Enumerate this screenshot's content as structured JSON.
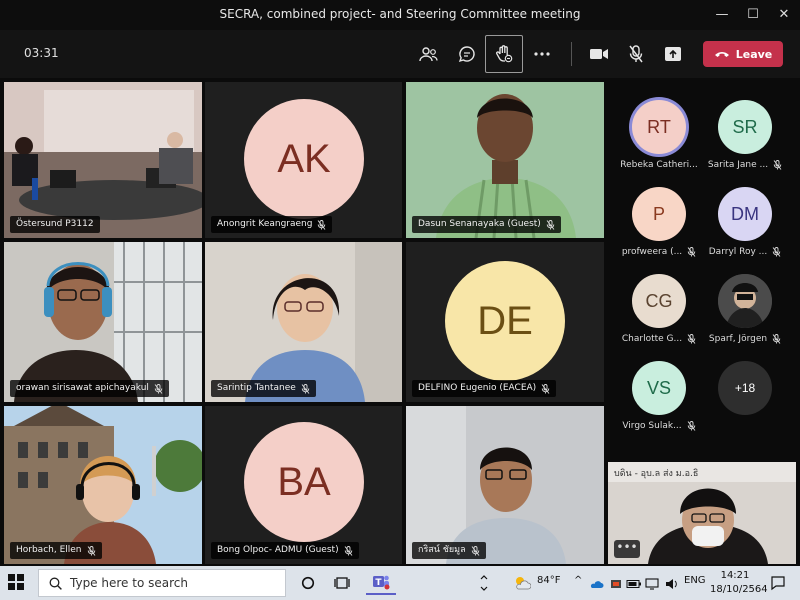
{
  "window": {
    "title": "SECRA, combined project- and Steering Committee meeting",
    "minimize_glyph": "—",
    "maximize_glyph": "☐",
    "close_glyph": "✕"
  },
  "toolbar": {
    "timer": "03:31",
    "buttons": [
      "people-icon",
      "chat-icon",
      "raise-hand-icon",
      "more-icon",
      "camera-icon",
      "mic-off-icon",
      "share-screen-icon"
    ],
    "leave_label": "Leave",
    "leave_color": "#c4314b"
  },
  "tiles": [
    {
      "name": "Östersund P3112",
      "type": "video"
    },
    {
      "name": "Anongrit Keangraeng",
      "initials": "AK",
      "type": "avatar",
      "color": "#f4cfc8",
      "text_color": "#7b2e22",
      "muted": true
    },
    {
      "name": "Dasun Senanayaka (Guest)",
      "type": "video",
      "muted": true
    },
    {
      "name": "orawan sirisawat apichayakul",
      "type": "video",
      "muted": true
    },
    {
      "name": "Sarintip Tantanee",
      "type": "video",
      "muted": true
    },
    {
      "name": "DELFINO Eugenio (EACEA)",
      "initials": "DE",
      "type": "avatar",
      "color": "#f8e6a8",
      "text_color": "#6b4f14",
      "muted": true
    },
    {
      "name": "Horbach, Ellen",
      "type": "video",
      "muted": true
    },
    {
      "name": "Bong Olpoc- ADMU (Guest)",
      "initials": "BA",
      "type": "avatar",
      "color": "#f4cfc8",
      "text_color": "#7b2e22",
      "muted": true
    },
    {
      "name": "กริสน์ ชัยมูล",
      "type": "video",
      "muted": true
    }
  ],
  "self_view": {
    "sign_text": "บดิน - อุบ.ล ส่ง ม.อ.ธิ",
    "more_label": "•••"
  },
  "roster": [
    {
      "initials": "RT",
      "name": "Rebeka Catheri...",
      "color": "#f4cfc8",
      "text_color": "#7b2e22",
      "muted": false,
      "speaking": true
    },
    {
      "initials": "SR",
      "name": "Sarita Jane ...",
      "color": "#c9eede",
      "text_color": "#1f6b4a",
      "muted": true
    },
    {
      "initials": "P",
      "name": "profweera (...",
      "color": "#f8d6c6",
      "text_color": "#8a3a1f",
      "muted": true
    },
    {
      "initials": "DM",
      "name": "Darryl Roy ...",
      "color": "#d9d6f3",
      "text_color": "#3a3580",
      "muted": true
    },
    {
      "initials": "CG",
      "name": "Charlotte G...",
      "color": "#e8dccf",
      "text_color": "#5a4330",
      "muted": true
    },
    {
      "initials": "",
      "name": "Sparf, Jörgen",
      "photo": true,
      "muted": true
    },
    {
      "initials": "VS",
      "name": "Virgo Sulak...",
      "color": "#c9eede",
      "text_color": "#1f6b4a",
      "muted": true
    },
    {
      "initials": "+18",
      "name": "",
      "overflow": true
    }
  ],
  "taskbar": {
    "search_placeholder": "Type here to search",
    "weather": "84°F",
    "language": "ENG",
    "time": "14:21",
    "date": "18/10/2564"
  }
}
